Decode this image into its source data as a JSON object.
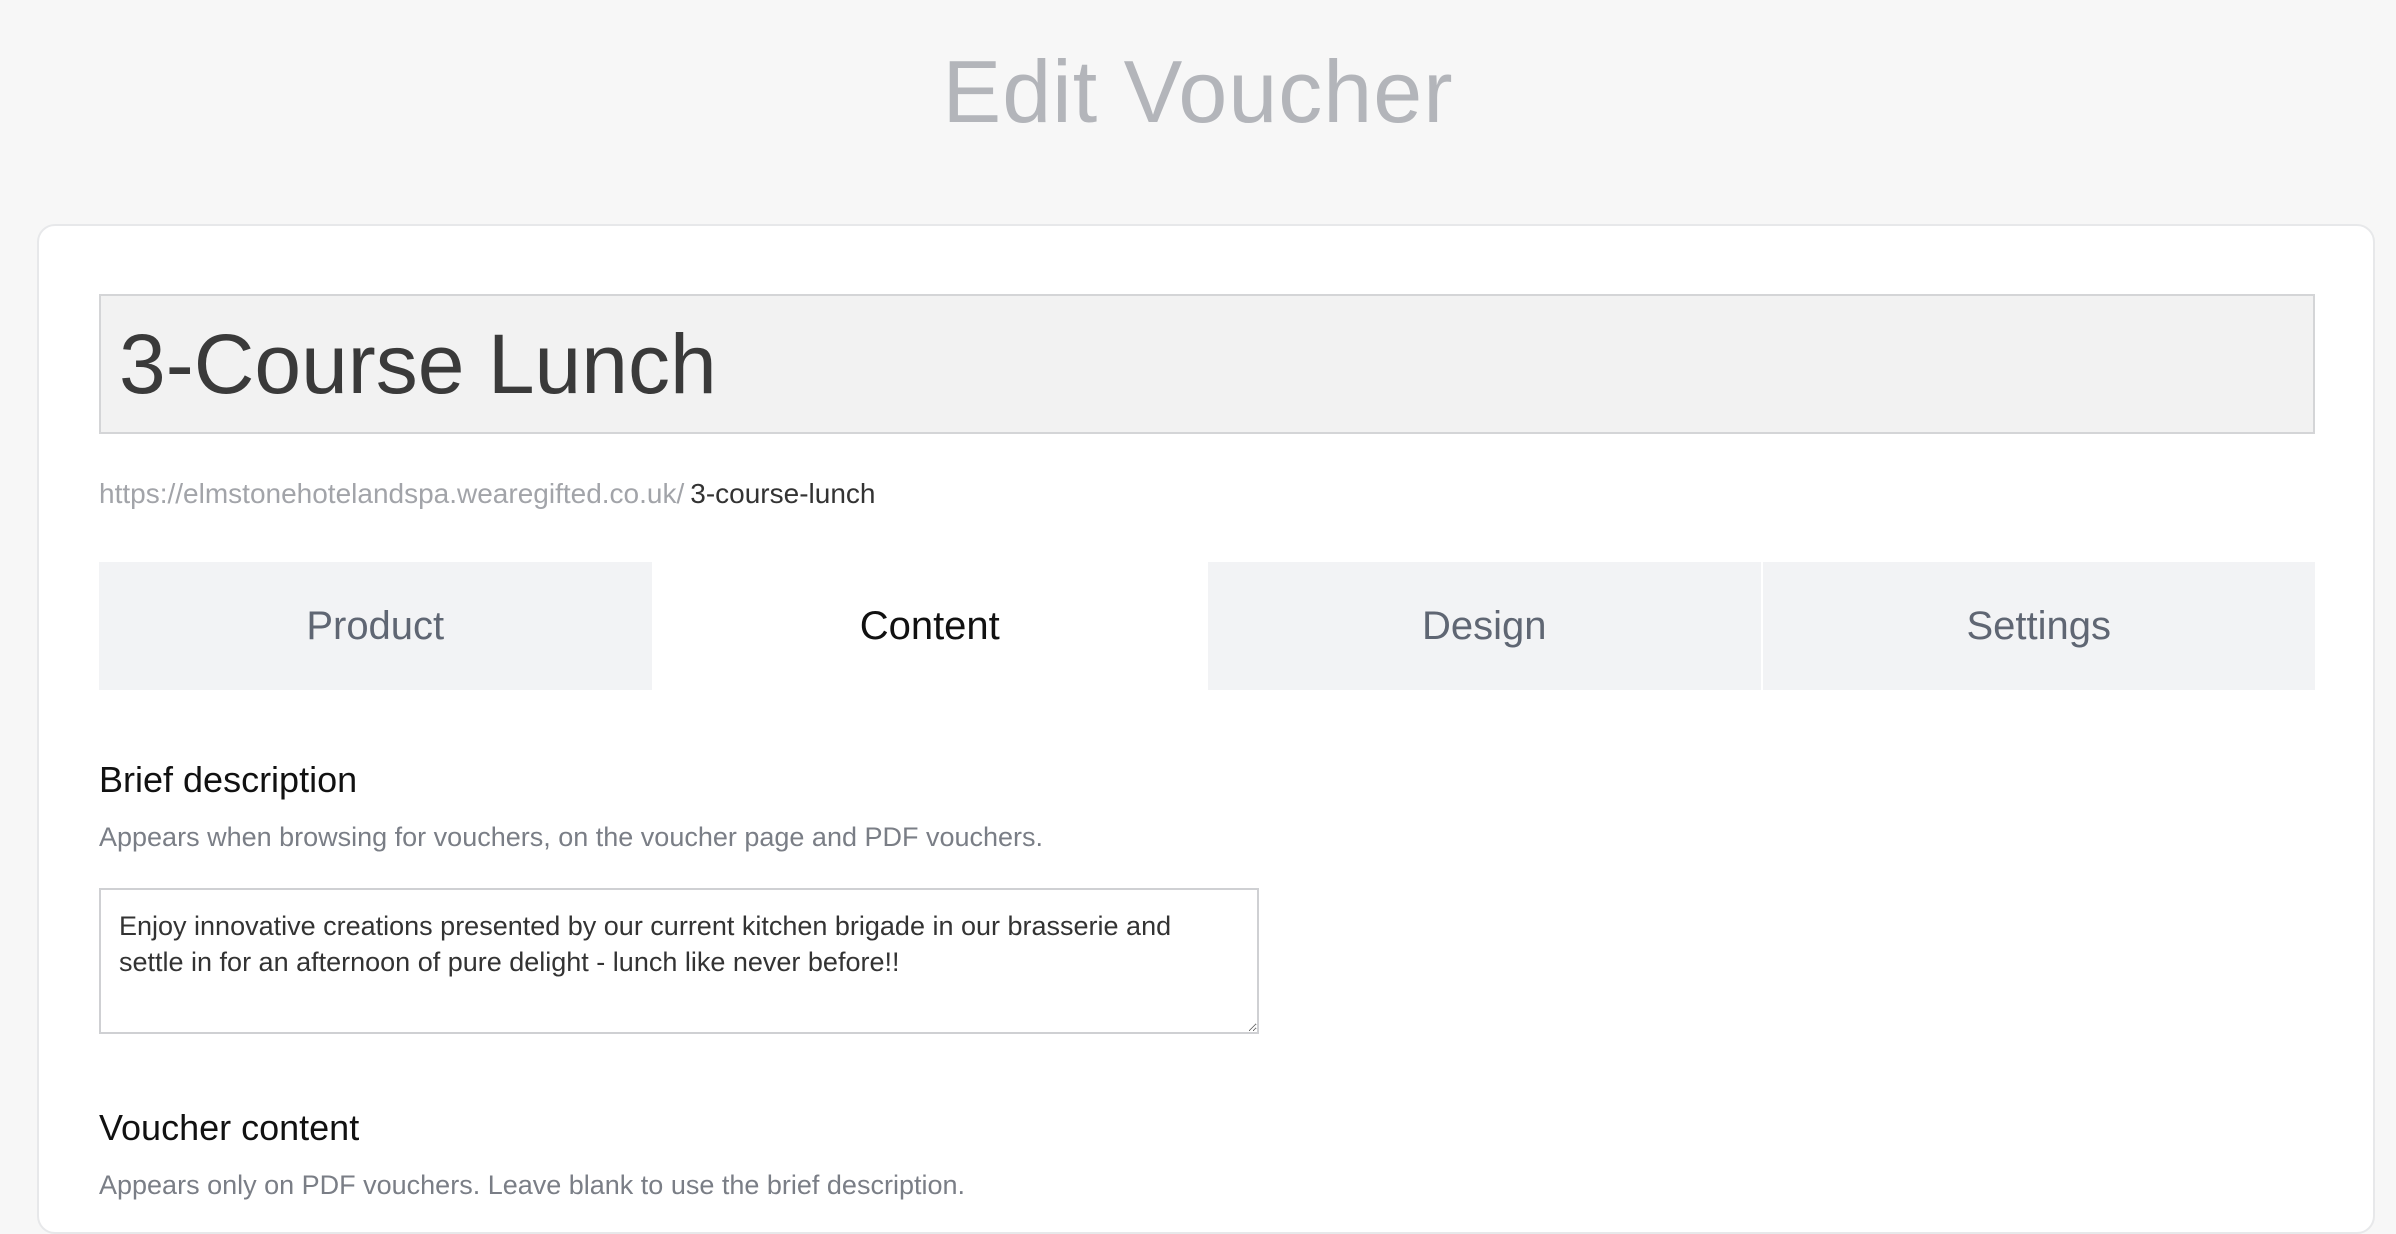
{
  "page": {
    "title": "Edit Voucher"
  },
  "voucher": {
    "name": "3-Course Lunch",
    "url_base": "https://elmstonehotelandspa.wearegifted.co.uk/",
    "url_slug": "3-course-lunch"
  },
  "tabs": [
    {
      "label": "Product"
    },
    {
      "label": "Content"
    },
    {
      "label": "Design"
    },
    {
      "label": "Settings"
    }
  ],
  "brief_description": {
    "heading": "Brief description",
    "help": "Appears when browsing for vouchers, on the voucher page and PDF vouchers.",
    "value": "Enjoy innovative creations presented by our current kitchen brigade in our brasserie and settle in for an afternoon of pure delight - lunch like never before!!"
  },
  "voucher_content": {
    "heading": "Voucher content",
    "help": "Appears only on PDF vouchers. Leave blank to use the brief description."
  }
}
